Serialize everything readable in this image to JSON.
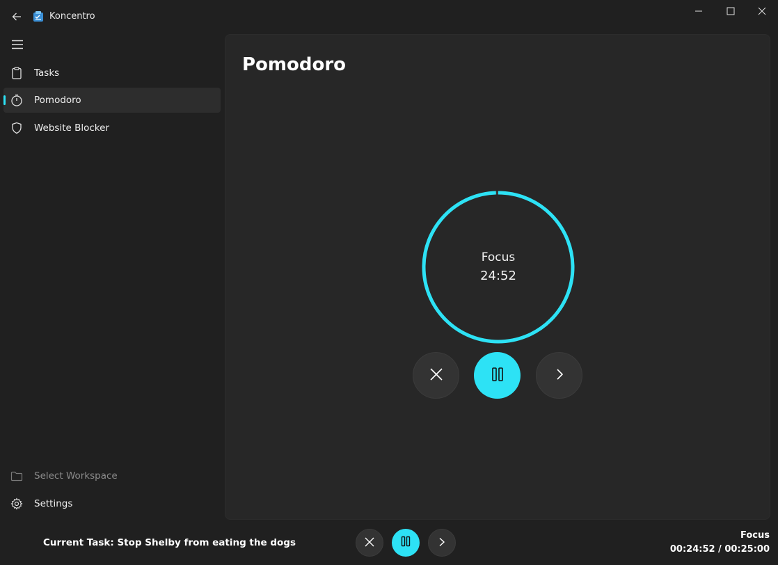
{
  "window": {
    "title": "Koncentro",
    "icons": [
      "back-arrow-icon",
      "app-logo-icon",
      "minimize-icon",
      "maximize-icon",
      "close-icon"
    ]
  },
  "sidebar": {
    "menu_icon": "hamburger-icon",
    "items": [
      {
        "label": "Tasks",
        "icon": "clipboard-icon",
        "active": false
      },
      {
        "label": "Pomodoro",
        "icon": "timer-icon",
        "active": true
      },
      {
        "label": "Website Blocker",
        "icon": "shield-icon",
        "active": false
      }
    ],
    "footer": [
      {
        "label": "Select Workspace",
        "icon": "folder-icon",
        "disabled": true
      },
      {
        "label": "Settings",
        "icon": "gear-icon",
        "disabled": false
      }
    ]
  },
  "main": {
    "title": "Pomodoro",
    "timer": {
      "mode": "Focus",
      "remaining": "24:52",
      "progress": 0.0053
    },
    "controls": [
      "stop-button",
      "pause-button",
      "skip-button"
    ]
  },
  "bottom_bar": {
    "current_task": "Current Task: Stop Shelby from eating the dogs",
    "mode": "Focus",
    "time": "00:24:52 / 00:25:00"
  },
  "colors": {
    "accent": "#2de2f5",
    "background": "#202020",
    "panel": "#272727",
    "button_secondary": "#333333"
  }
}
